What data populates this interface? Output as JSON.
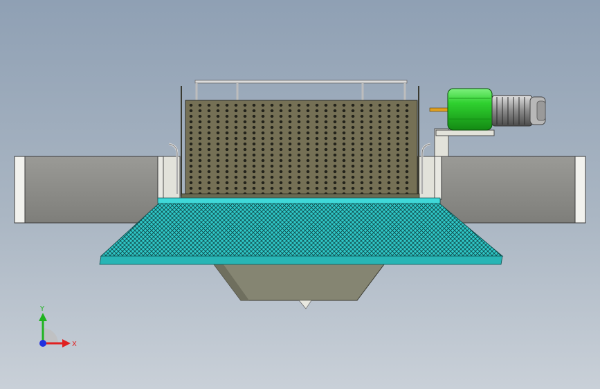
{
  "viewport": {
    "background_top": "#8fa0b4",
    "background_bottom": "#c9d0d8"
  },
  "model": {
    "components": [
      {
        "name": "left-conveyor-belt",
        "color": "#8a8a86"
      },
      {
        "name": "right-conveyor-belt",
        "color": "#8a8a86"
      },
      {
        "name": "perforated-drum-screen",
        "color": "#757055"
      },
      {
        "name": "top-guard-rail",
        "color": "#c8c8c8"
      },
      {
        "name": "drive-motor",
        "color": "#2fd12f"
      },
      {
        "name": "gearbox",
        "color": "#a0a0a0"
      },
      {
        "name": "mesh-feed-table",
        "color": "#2fc4c4"
      },
      {
        "name": "collection-hopper",
        "color": "#858572"
      }
    ]
  },
  "triad": {
    "y_label": "Y",
    "x_label": "X",
    "y_color": "#1fb31f",
    "x_color": "#e02020",
    "z_color": "#2030e0"
  }
}
